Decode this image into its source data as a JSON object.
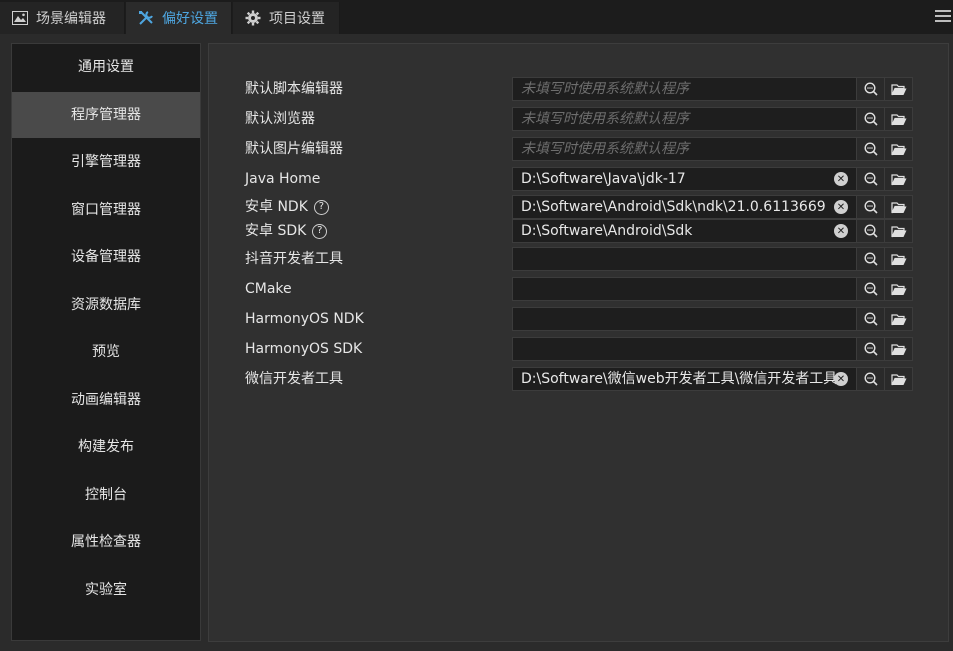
{
  "tabs": [
    {
      "label": "场景编辑器",
      "icon": "scene-icon"
    },
    {
      "label": "偏好设置",
      "icon": "tools-icon",
      "active": true
    },
    {
      "label": "项目设置",
      "icon": "gear-icon"
    }
  ],
  "sidebar": {
    "items": [
      {
        "label": "通用设置"
      },
      {
        "label": "程序管理器",
        "active": true
      },
      {
        "label": "引擎管理器"
      },
      {
        "label": "窗口管理器"
      },
      {
        "label": "设备管理器"
      },
      {
        "label": "资源数据库"
      },
      {
        "label": "预览"
      },
      {
        "label": "动画编辑器"
      },
      {
        "label": "构建发布"
      },
      {
        "label": "控制台"
      },
      {
        "label": "属性检查器"
      },
      {
        "label": "实验室"
      }
    ]
  },
  "rows": [
    {
      "label": "默认脚本编辑器",
      "value": "",
      "placeholder": "未填写时使用系统默认程序"
    },
    {
      "label": "默认浏览器",
      "value": "",
      "placeholder": "未填写时使用系统默认程序"
    },
    {
      "label": "默认图片编辑器",
      "value": "",
      "placeholder": "未填写时使用系统默认程序"
    },
    {
      "label": "Java Home",
      "value": "D:\\Software\\Java\\jdk-17",
      "placeholder": ""
    },
    {
      "label": "安卓 NDK",
      "help": "?",
      "value": "D:\\Software\\Android\\Sdk\\ndk\\21.0.6113669",
      "placeholder": ""
    },
    {
      "label": "安卓 SDK",
      "help": "?",
      "value": "D:\\Software\\Android\\Sdk",
      "placeholder": ""
    },
    {
      "label": "抖音开发者工具",
      "value": "",
      "placeholder": ""
    },
    {
      "label": "CMake",
      "value": "",
      "placeholder": ""
    },
    {
      "label": "HarmonyOS NDK",
      "value": "",
      "placeholder": ""
    },
    {
      "label": "HarmonyOS SDK",
      "value": "",
      "placeholder": ""
    },
    {
      "label": "微信开发者工具",
      "value": "D:\\Software\\微信web开发者工具\\微信开发者工具",
      "placeholder": ""
    }
  ]
}
